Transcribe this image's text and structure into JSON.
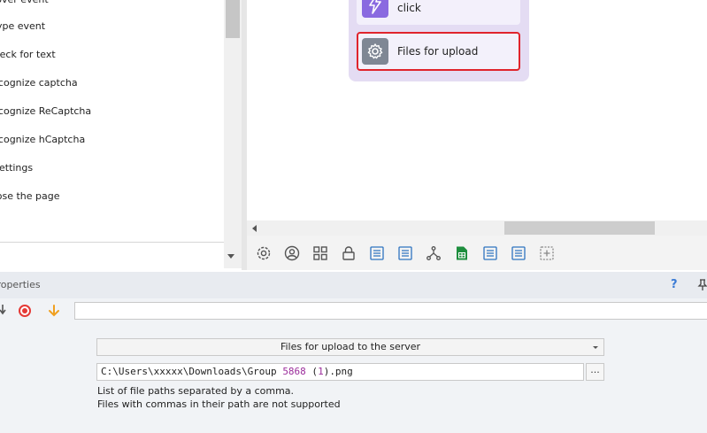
{
  "left_list": {
    "items": [
      {
        "label": "Hover event"
      },
      {
        "label": "Type event"
      },
      {
        "label": "Check for text"
      },
      {
        "label": "Recognize captcha"
      },
      {
        "label": "Recognize ReCaptcha"
      },
      {
        "label": "Recognize hCaptcha"
      },
      {
        "label": "Settings"
      },
      {
        "label": "Close the page"
      }
    ]
  },
  "canvas": {
    "nodes": [
      {
        "label": "click",
        "icon": "lightning-icon",
        "color": "#8a6ae0"
      },
      {
        "label": "Files for upload",
        "icon": "gear-icon",
        "color": "#7f8794",
        "selected": true,
        "border_color": "#e0242c"
      }
    ]
  },
  "toolbar": {
    "buttons": [
      "settings-icon",
      "user-icon",
      "grid-icon",
      "lock-icon",
      "list-icon",
      "list-icon",
      "branch-icon",
      "sheet-icon",
      "list-icon",
      "list-icon",
      "add-block-icon"
    ]
  },
  "properties": {
    "title": "Properties",
    "help": "?",
    "mode_select": "Files for upload to the server",
    "file_path_prefix": "C:\\Users\\xxxxx\\Downloads\\Group ",
    "file_path_number": "5868",
    "file_path_num2": "1",
    "file_path_suffix": ".png",
    "browse_label": "...",
    "hint_line1": "List of file paths separated by a comma.",
    "hint_line2": "Files with commas in their path are not supported"
  }
}
